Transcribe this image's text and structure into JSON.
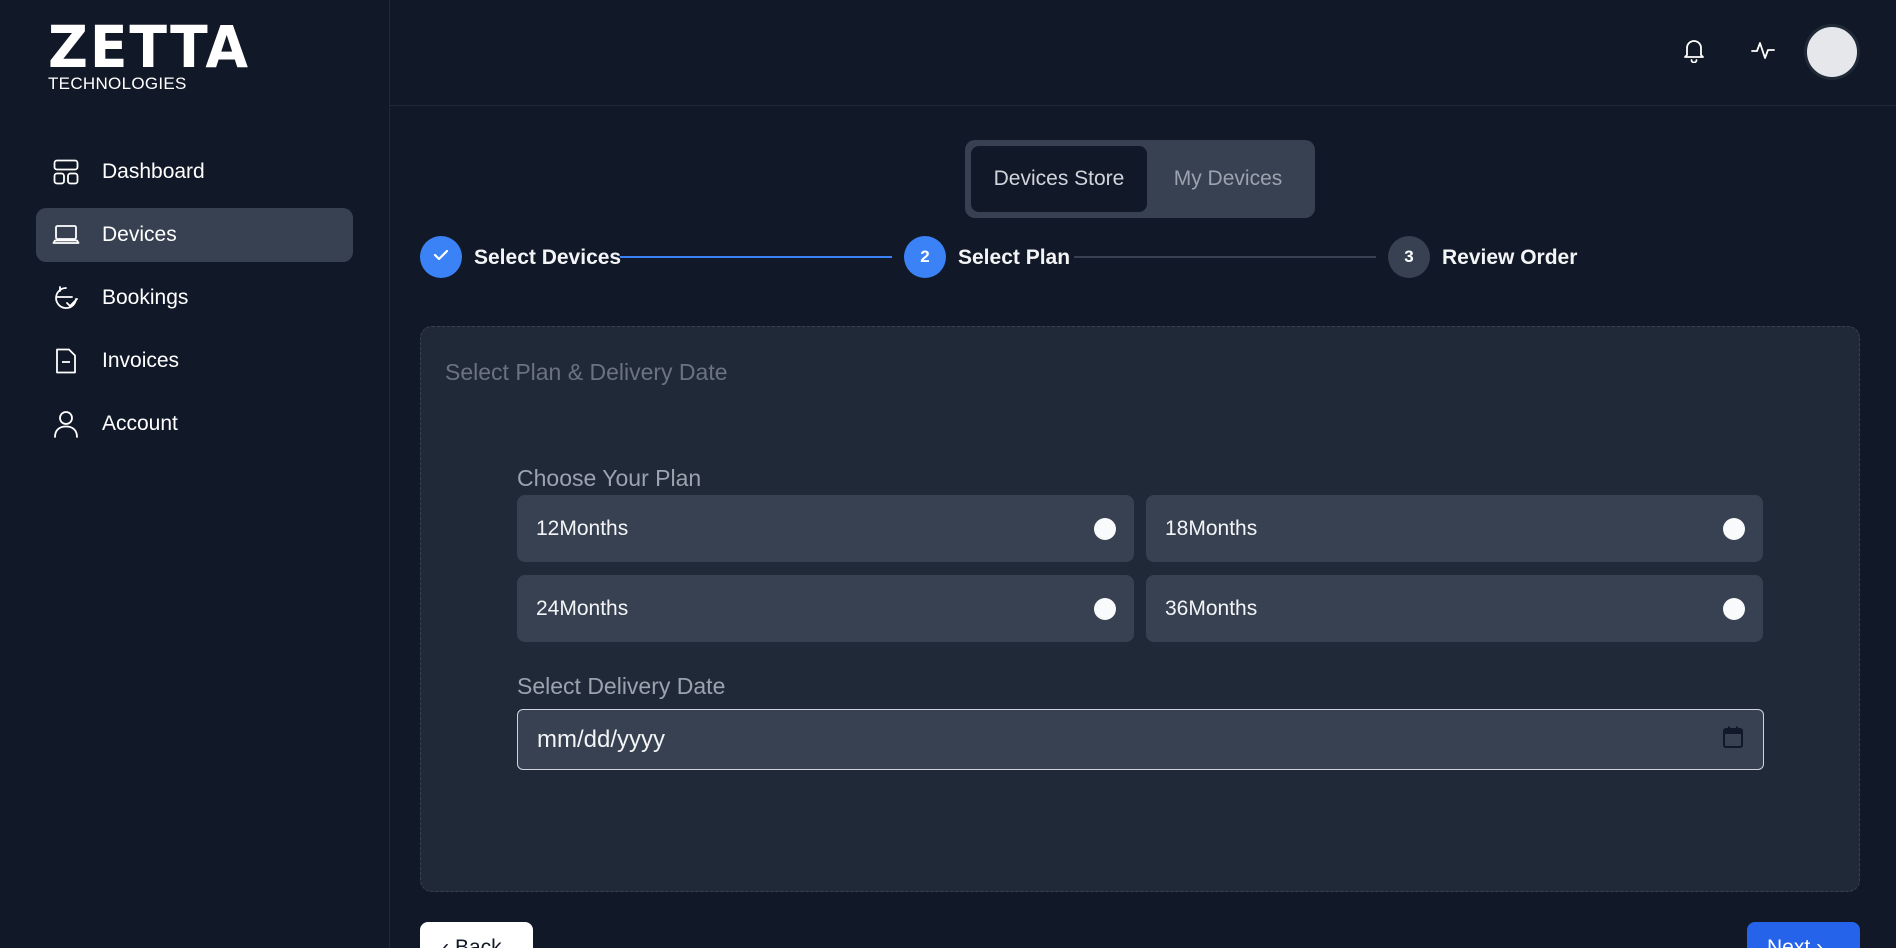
{
  "brand": {
    "mark": "ZETTA",
    "sub": "TECHNOLOGIES"
  },
  "sidebar": {
    "items": [
      {
        "label": "Dashboard",
        "icon": "dashboard-grid-icon",
        "active": false
      },
      {
        "label": "Devices",
        "icon": "laptop-icon",
        "active": true
      },
      {
        "label": "Bookings",
        "icon": "calendar-check-icon",
        "active": false
      },
      {
        "label": "Invoices",
        "icon": "invoice-icon",
        "active": false
      },
      {
        "label": "Account",
        "icon": "user-icon",
        "active": false
      }
    ]
  },
  "header": {
    "icons": [
      "bell-icon",
      "activity-icon",
      "avatar"
    ]
  },
  "tabs": [
    {
      "label": "Devices Store",
      "active": true
    },
    {
      "label": "My Devices",
      "active": false
    }
  ],
  "stepper": {
    "steps": [
      {
        "label": "Select Devices",
        "marker": "",
        "state": "completed"
      },
      {
        "label": "Select Plan",
        "marker": "2",
        "state": "current"
      },
      {
        "label": "Review Order",
        "marker": "3",
        "state": "upcoming"
      }
    ]
  },
  "card": {
    "title": "Select Plan & Delivery Date",
    "plan_label": "Choose Your Plan",
    "plans": [
      "12Months",
      "18Months",
      "24Months",
      "36Months"
    ],
    "date_label": "Select Delivery Date",
    "date_placeholder": "mm/dd/yyyy"
  },
  "actions": {
    "back": "Back",
    "next": "Next"
  },
  "colors": {
    "accent": "#3b82f6",
    "primary_button": "#2563eb",
    "background": "#111827",
    "card": "#1f2937"
  }
}
